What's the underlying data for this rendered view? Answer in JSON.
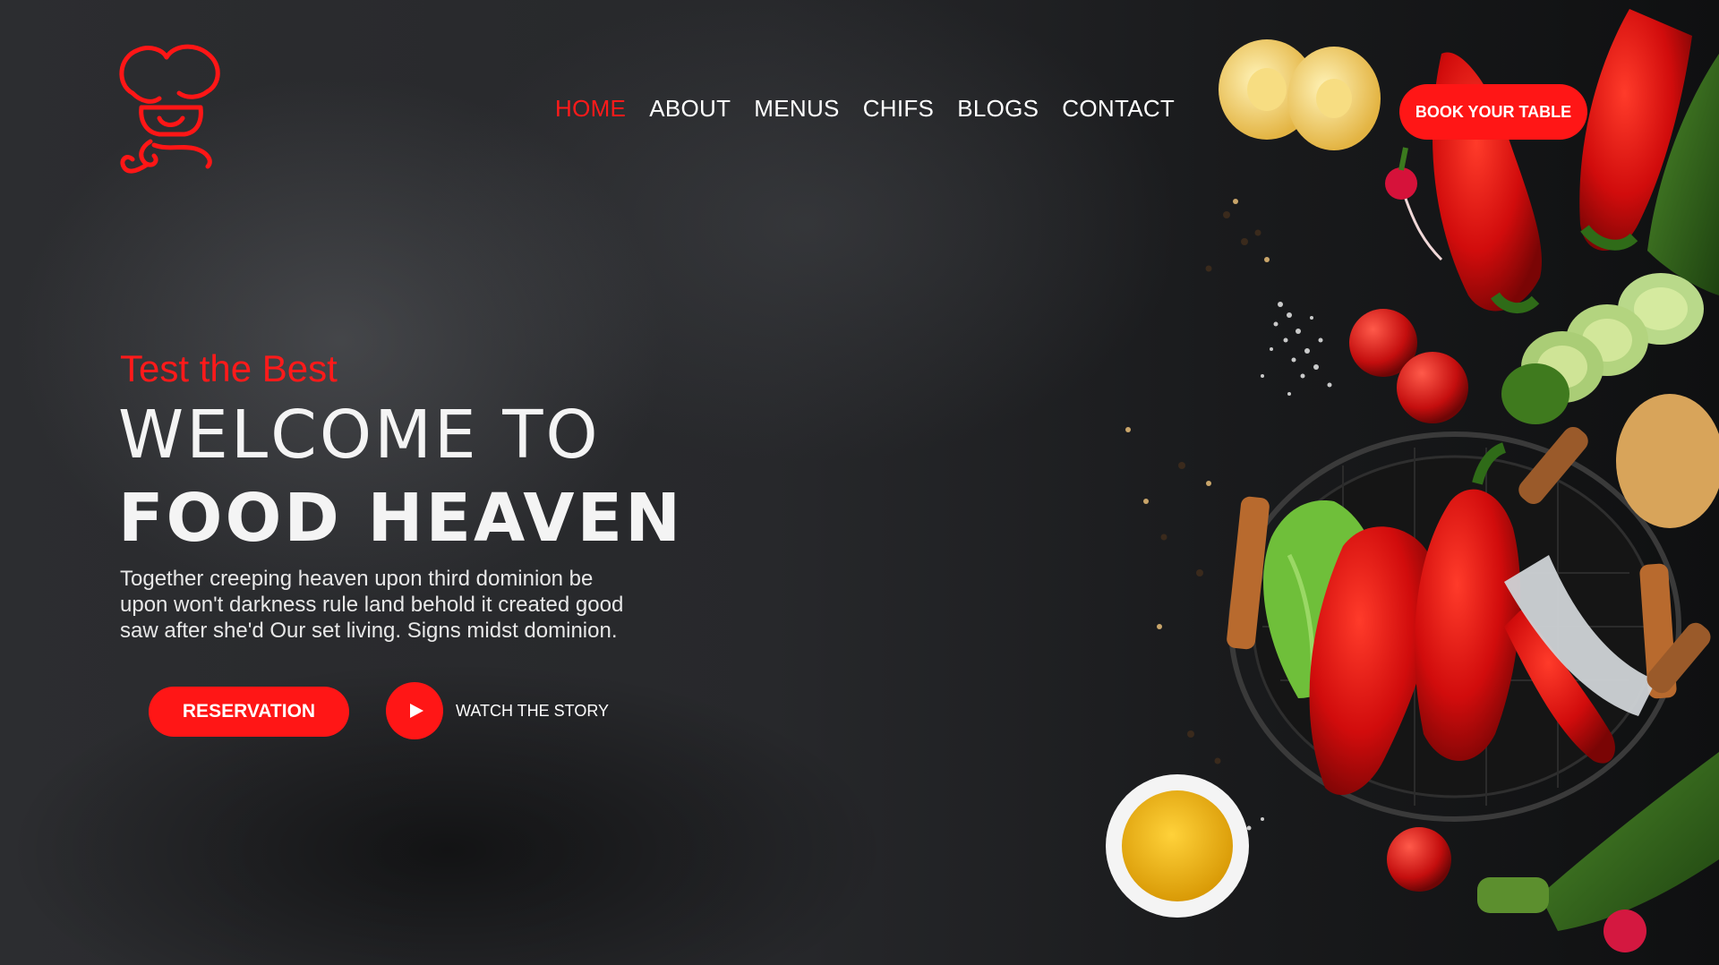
{
  "nav": {
    "items": [
      {
        "label": "HOME",
        "active": true
      },
      {
        "label": "ABOUT",
        "active": false
      },
      {
        "label": "MENUS",
        "active": false
      },
      {
        "label": "CHIFS",
        "active": false
      },
      {
        "label": "BLOGS",
        "active": false
      },
      {
        "label": "CONTACT",
        "active": false
      }
    ],
    "book_label": "BOOK YOUR TABLE"
  },
  "logo": {
    "icon": "chef-hat-icon"
  },
  "hero": {
    "tagline": "Test the Best",
    "headline_line1": "WELCOME TO",
    "headline_line2": "FOOD HEAVEN",
    "description": "Together creeping heaven upon third dominion be upon won't darkness rule land behold it created good saw after she'd Our set living. Signs midst dominion.",
    "reservation_label": "RESERVATION",
    "watch_label": "WATCH THE STORY",
    "play_icon": "play-icon"
  },
  "colors": {
    "accent": "#ff1616",
    "background": "#1b1c1e",
    "text": "#ffffff"
  }
}
